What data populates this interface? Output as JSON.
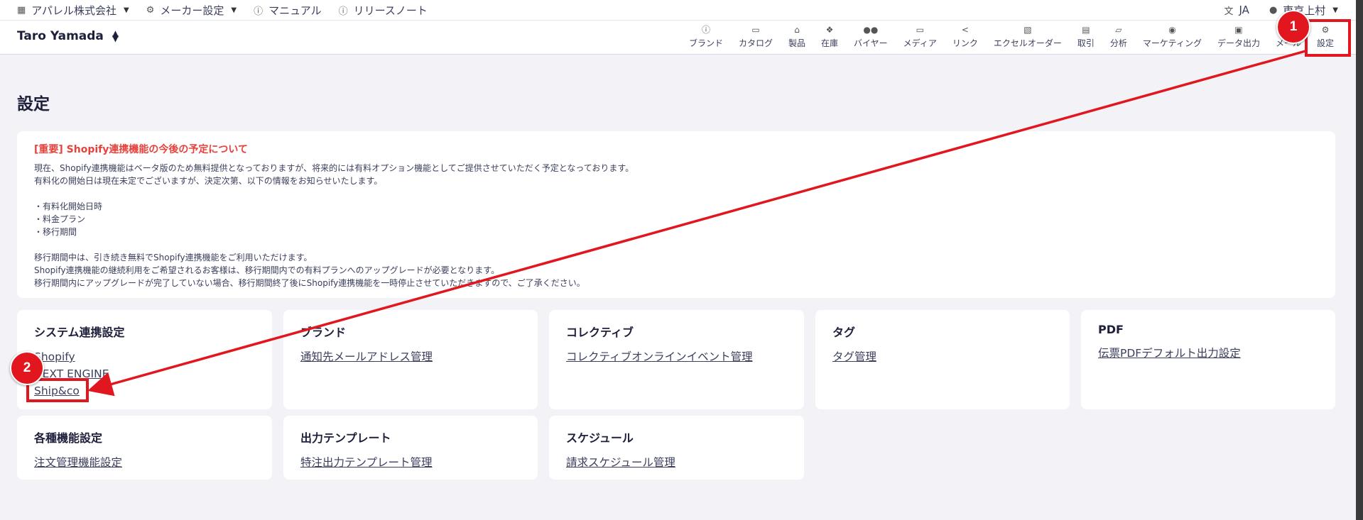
{
  "topbar": {
    "company": "アパレル株式会社",
    "maker_settings": "メーカー設定",
    "manual": "マニュアル",
    "release_notes": "リリースノート",
    "language": "JA",
    "user": "東京上村"
  },
  "header": {
    "account_name": "Taro Yamada",
    "nav": [
      {
        "label": "ブランド",
        "icon": "info-icon"
      },
      {
        "label": "カタログ",
        "icon": "catalog-icon"
      },
      {
        "label": "製品",
        "icon": "hanger-icon"
      },
      {
        "label": "在庫",
        "icon": "stock-icon"
      },
      {
        "label": "バイヤー",
        "icon": "people-icon"
      },
      {
        "label": "メディア",
        "icon": "cast-icon"
      },
      {
        "label": "リンク",
        "icon": "share-icon"
      },
      {
        "label": "エクセルオーダー",
        "icon": "excel-icon"
      },
      {
        "label": "取引",
        "icon": "chat-icon"
      },
      {
        "label": "分析",
        "icon": "chart-icon"
      },
      {
        "label": "マーケティング",
        "icon": "broadcast-icon"
      },
      {
        "label": "データ出力",
        "icon": "export-icon"
      },
      {
        "label": "メール",
        "icon": "mail-icon"
      },
      {
        "label": "設定",
        "icon": "gear-icon"
      }
    ]
  },
  "page": {
    "title": "設定"
  },
  "notice": {
    "title": "[重要] Shopify連携機能の今後の予定について",
    "lines": [
      "現在、Shopify連携機能はベータ版のため無料提供となっておりますが、将来的には有料オプション機能としてご提供させていただく予定となっております。",
      "有料化の開始日は現在未定でございますが、決定次第、以下の情報をお知らせいたします。",
      "",
      "・有料化開始日時",
      "・料金プラン",
      "・移行期間",
      "",
      "移行期間中は、引き続き無料でShopify連携機能をご利用いただけます。",
      "Shopify連携機能の継続利用をご希望されるお客様は、移行期間内での有料プランへのアップグレードが必要となります。",
      "移行期間内にアップグレードが完了していない場合、移行期間終了後にShopify連携機能を一時停止させていただきますので、ご了承ください。"
    ]
  },
  "cards": {
    "system": {
      "title": "システム連携設定",
      "links": [
        "Shopify",
        "NEXT ENGINE",
        "Ship&co"
      ]
    },
    "brand": {
      "title": "ブランド",
      "links": [
        "通知先メールアドレス管理"
      ]
    },
    "collective": {
      "title": "コレクティブ",
      "links": [
        "コレクティブオンラインイベント管理"
      ]
    },
    "tag": {
      "title": "タグ",
      "links": [
        "タグ管理"
      ]
    },
    "pdf": {
      "title": "PDF",
      "links": [
        "伝票PDFデフォルト出力設定"
      ]
    },
    "features": {
      "title": "各種機能設定",
      "links": [
        "注文管理機能設定"
      ]
    },
    "output": {
      "title": "出力テンプレート",
      "links": [
        "特注出力テンプレート管理"
      ]
    },
    "schedule": {
      "title": "スケジュール",
      "links": [
        "請求スケジュール管理"
      ]
    }
  },
  "annotations": {
    "step1": "1",
    "step2": "2",
    "color": "#e2161e"
  }
}
